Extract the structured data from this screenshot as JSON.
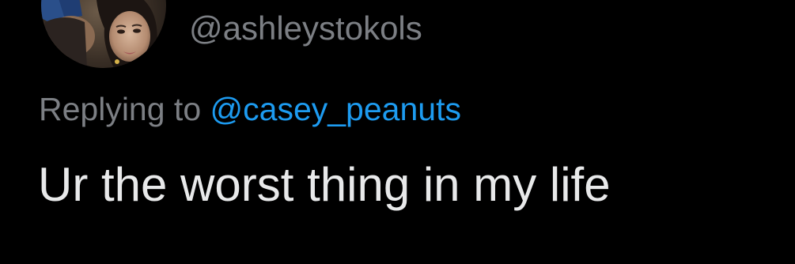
{
  "tweet": {
    "handle": "@ashleystokols",
    "replying_prefix": "Replying to",
    "replying_to": "@casey_peanuts",
    "text": "Ur the worst thing in my life"
  },
  "colors": {
    "background": "#000000",
    "secondary_text": "#7c7f84",
    "link": "#1d9bf0",
    "primary_text": "#e8e9ea"
  },
  "icons": {
    "avatar": "profile-avatar"
  }
}
